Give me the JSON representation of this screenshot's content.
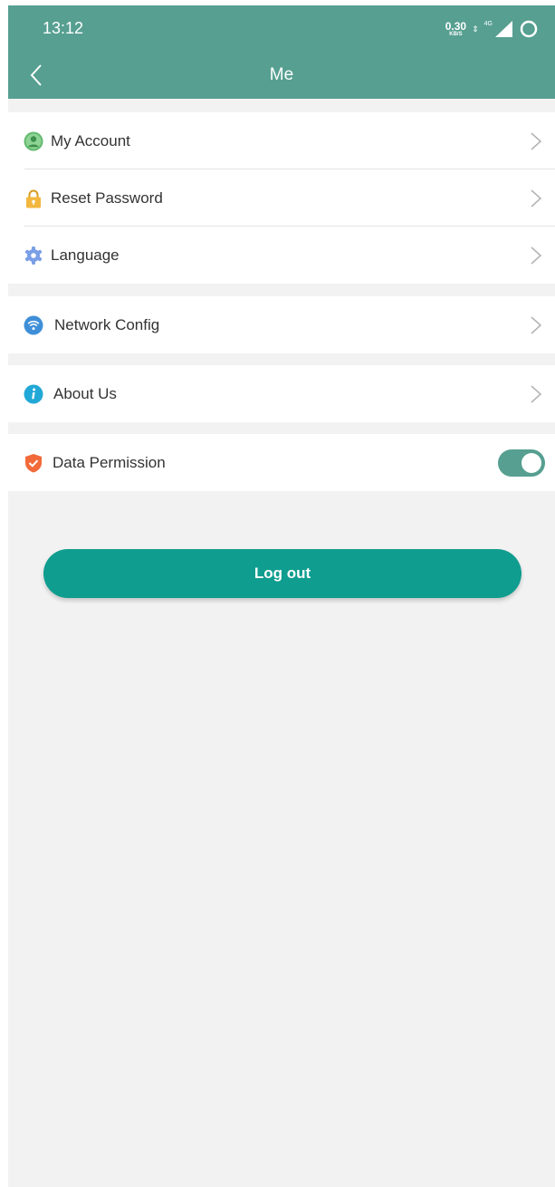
{
  "status_bar": {
    "time": "13:12",
    "net_speed_value": "0.30",
    "net_speed_unit": "KB/S",
    "network_type": "4G"
  },
  "header": {
    "title": "Me",
    "back_icon": "chevron-left-icon"
  },
  "menu": {
    "account": {
      "label": "My Account",
      "icon": "account-icon"
    },
    "reset_password": {
      "label": "Reset Password",
      "icon": "lock-icon"
    },
    "language": {
      "label": "Language",
      "icon": "gear-icon"
    },
    "network_config": {
      "label": "Network Config",
      "icon": "wifi-icon"
    },
    "about_us": {
      "label": "About Us",
      "icon": "info-icon"
    },
    "data_permission": {
      "label": "Data Permission",
      "icon": "shield-icon",
      "enabled": true
    }
  },
  "logout": {
    "label": "Log out"
  },
  "colors": {
    "header": "#569f91",
    "logout_button": "#0f9d8f",
    "background": "#f2f2f2"
  }
}
